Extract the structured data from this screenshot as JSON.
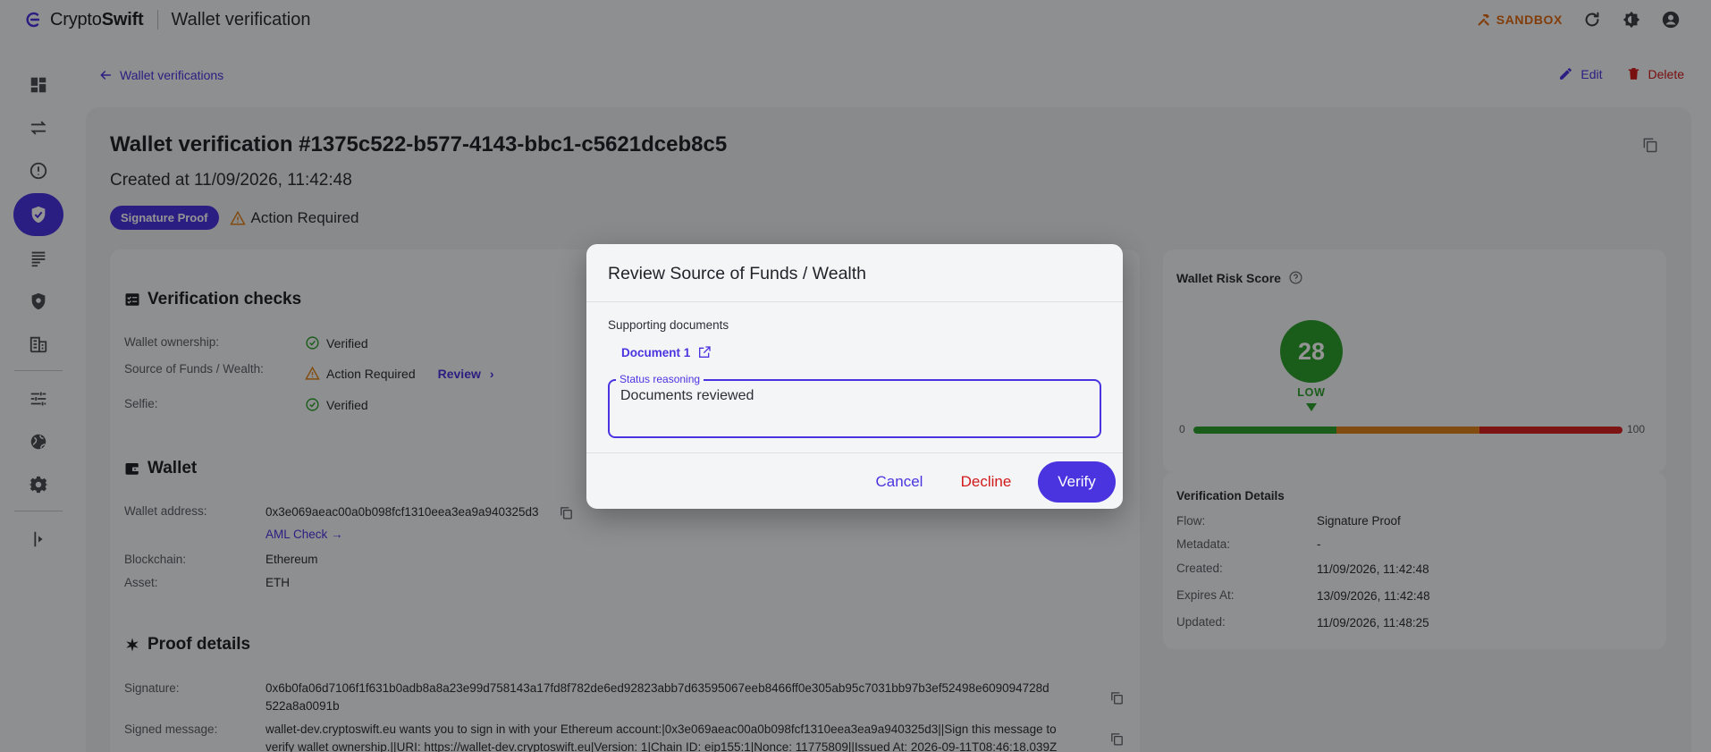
{
  "topbar": {
    "brand_light": "Crypto",
    "brand_bold": "Swift",
    "page_title": "Wallet verification",
    "sandbox_label": "SANDBOX"
  },
  "breadcrumb": {
    "back_label": "Wallet verifications"
  },
  "actions": {
    "edit_label": "Edit",
    "delete_label": "Delete"
  },
  "header": {
    "title": "Wallet verification #1375c522-b577-4143-bbc1-c5621dceb8c5",
    "created": "Created at 11/09/2026, 11:42:48",
    "badge": "Signature Proof",
    "status": "Action Required"
  },
  "checks": {
    "title": "Verification checks",
    "rows": [
      {
        "label": "Wallet ownership:",
        "value": "Verified"
      },
      {
        "label": "Source of Funds / Wealth:",
        "value": "Action Required",
        "link": "Review"
      },
      {
        "label": "Selfie:",
        "value": "Verified"
      }
    ]
  },
  "wallet": {
    "title": "Wallet",
    "address_label": "Wallet address:",
    "address": "0x3e069aeac00a0b098fcf1310eea3ea9a940325d3",
    "aml_link": "AML Check →",
    "blockchain_label": "Blockchain:",
    "blockchain": "Ethereum",
    "asset_label": "Asset:",
    "asset": "ETH"
  },
  "proof": {
    "title": "Proof details",
    "signature_label": "Signature:",
    "signature_line1": "0x6b0fa06d7106f1f631b0adb8a8a23e99d758143a17fd8f782de6ed92823abb7d63595067eeb8466ff0e305ab95c7031bb97b3ef52498e609094728d",
    "signature_line2": "522a8a0091b",
    "message_label": "Signed message:",
    "message_line1": "wallet-dev.cryptoswift.eu wants you to sign in with your Ethereum account:|0x3e069aeac00a0b098fcf1310eea3ea9a940325d3||Sign this message to",
    "message_line2": "verify wallet ownership.||URI: https://wallet-dev.cryptoswift.eu|Version: 1|Chain ID: eip155:1|Nonce: 11775809||Issued At: 2026-09-11T08:46:18.039Z"
  },
  "risk": {
    "title": "Wallet Risk Score",
    "score": "28",
    "level": "LOW",
    "min": "0",
    "max": "100",
    "colors": {
      "low": "#2e9f2e",
      "medium": "#e0821a",
      "high": "#d82424"
    }
  },
  "details": {
    "title": "Verification Details",
    "rows": [
      {
        "label": "Flow:",
        "value": "Signature Proof"
      },
      {
        "label": "Metadata:",
        "value": "-"
      },
      {
        "label": "Created:",
        "value": "11/09/2026, 11:42:48"
      },
      {
        "label": "Expires At:",
        "value": "13/09/2026, 11:42:48"
      },
      {
        "label": "Updated:",
        "value": "11/09/2026, 11:48:25"
      }
    ]
  },
  "dialog": {
    "title": "Review Source of Funds / Wealth",
    "supporting_label": "Supporting documents",
    "document_link": "Document 1",
    "field_label": "Status reasoning",
    "field_value": "Documents reviewed",
    "cancel_label": "Cancel",
    "decline_label": "Decline",
    "verify_label": "Verify"
  },
  "accent_color": "#4a34e0",
  "danger_color": "#d11a1a",
  "warning_color": "#e0821a",
  "icons": [
    "logo-icon",
    "hammer-icon",
    "refresh-icon",
    "theme-icon",
    "account-icon",
    "dashboard-icon",
    "transfer-icon",
    "alert-icon",
    "shield-check-icon",
    "list-icon",
    "shield-search-icon",
    "building-icon",
    "sliders-icon",
    "globe-icon",
    "gear-icon",
    "collapse-icon",
    "copy-icon",
    "external-link-icon"
  ]
}
